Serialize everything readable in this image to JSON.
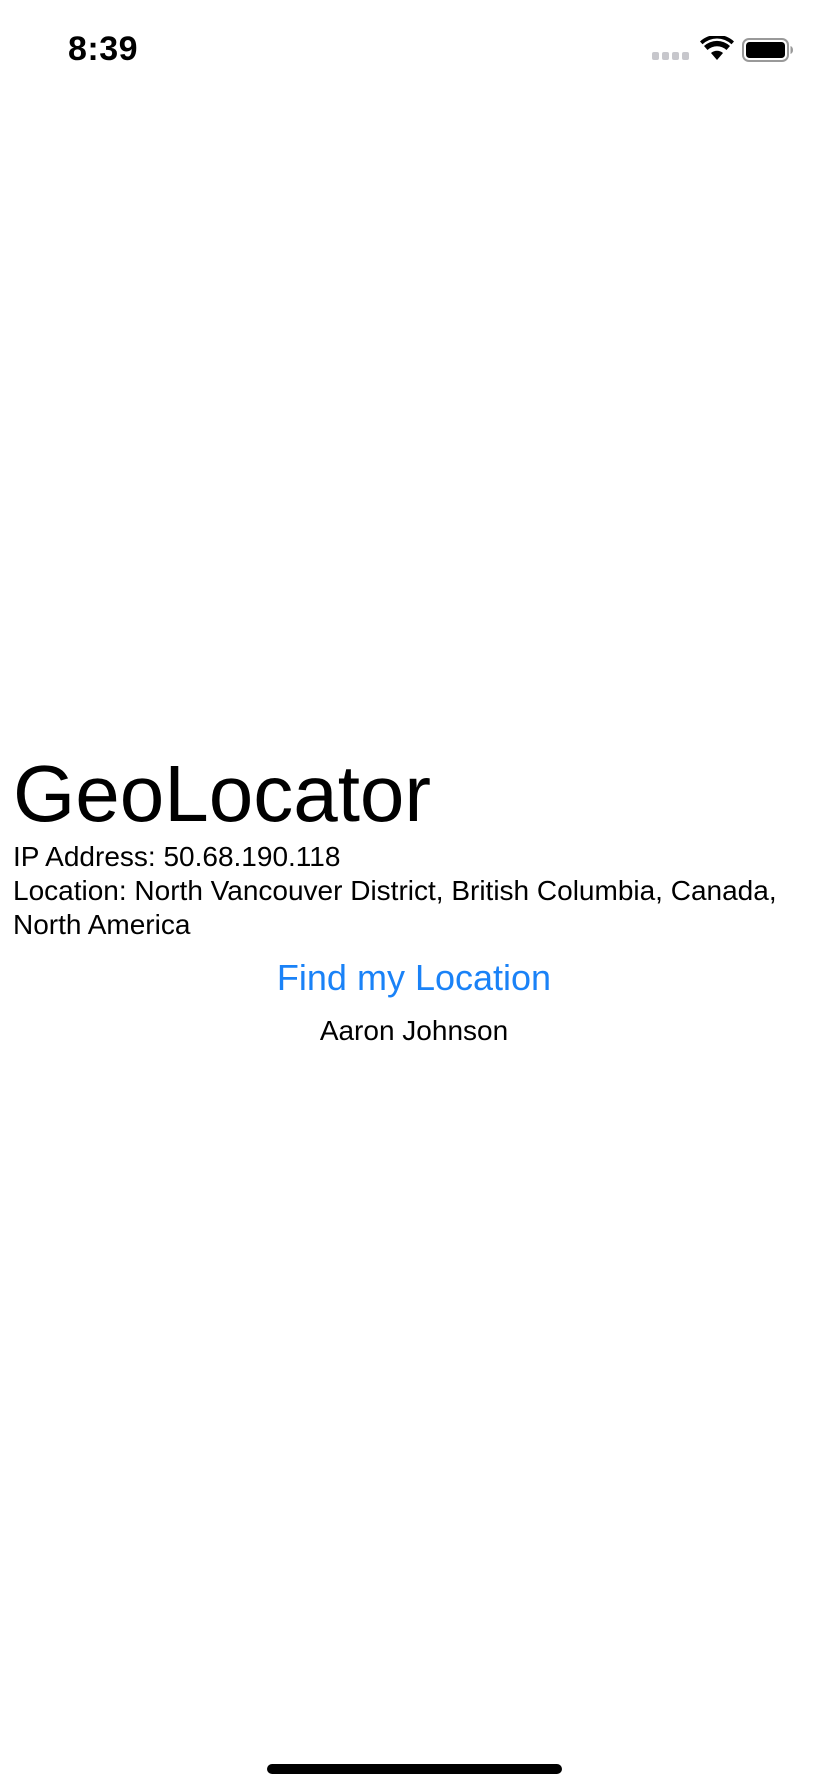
{
  "status_bar": {
    "time": "8:39",
    "icons": [
      "cellular-signal-icon",
      "wifi-icon",
      "battery-icon"
    ]
  },
  "app": {
    "title": "GeoLocator",
    "ip_line": "IP Address: 50.68.190.118",
    "location_line": "Location: North Vancouver District, British Columbia, Canada, North America",
    "find_button_label": "Find my Location",
    "author": "Aaron Johnson"
  },
  "colors": {
    "accent": "#1a82f7",
    "text": "#000000",
    "background": "#ffffff"
  }
}
